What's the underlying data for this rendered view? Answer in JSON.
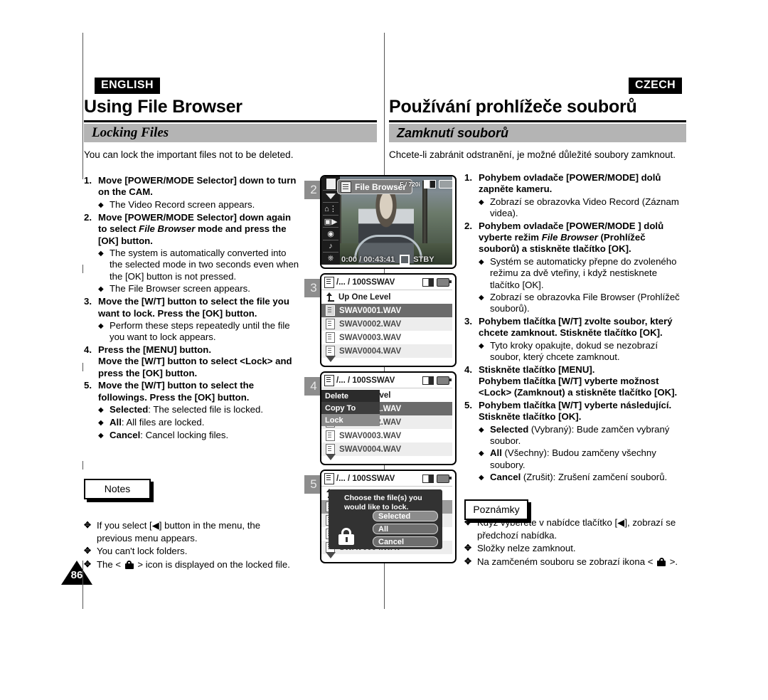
{
  "left": {
    "language_tag": "ENGLISH",
    "chapter_title": "Using File Browser",
    "section_title": "Locking Files",
    "intro": "You can lock the important files not to be deleted.",
    "steps": [
      {
        "num": "1.",
        "head_pre": "Move [POWER/MODE Selector] down to turn on the CAM.",
        "subs": [
          {
            "bold": "",
            "text": "The Video Record screen appears."
          }
        ]
      },
      {
        "num": "2.",
        "head_pre": "Move [POWER/MODE Selector] down again to select ",
        "head_ital": "File Browser",
        "head_post": " mode and press the [OK] button.",
        "subs": [
          {
            "bold": "",
            "text": "The system is automatically converted into the selected mode in two seconds even when the [OK] button is not pressed."
          },
          {
            "bold": "",
            "text": "The File Browser screen appears."
          }
        ]
      },
      {
        "num": "3.",
        "head_pre": "Move the [W/T] button to select the file you want to lock. Press the [OK] button.",
        "subs": [
          {
            "bold": "",
            "text": "Perform these steps repeatedly until the file you want to lock appears."
          }
        ]
      },
      {
        "num": "4.",
        "head_pre": "Press the [MENU] button.\nMove the [W/T] button to select <Lock> and press the [OK] button.",
        "subs": []
      },
      {
        "num": "5.",
        "head_pre": "Move the  [W/T] button to select the followings. Press the [OK] button.",
        "subs": [
          {
            "bold": "Selected",
            "text": ": The selected file is locked."
          },
          {
            "bold": "All",
            "text": ": All files are locked."
          },
          {
            "bold": "Cancel",
            "text": ": Cancel locking files."
          }
        ]
      }
    ],
    "notes_label": "Notes",
    "notes": [
      {
        "text": "If you select [◀] button in the menu, the previous menu appears.",
        "has_lock": false
      },
      {
        "text": "You can't lock folders.",
        "has_lock": false
      },
      {
        "pre": "The < ",
        "post": " > icon is displayed on the locked file.",
        "has_lock": true
      }
    ],
    "page_number": "86"
  },
  "right": {
    "language_tag": "CZECH",
    "chapter_title": "Používání prohlížeče souborů",
    "section_title": "Zamknutí souborů",
    "intro": "Chcete-li zabránit odstranění, je možné důležité soubory zamknout.",
    "steps": [
      {
        "num": "1.",
        "head_pre": "Pohybem ovladače [POWER/MODE] dolů zapněte kameru.",
        "subs": [
          {
            "bold": "",
            "text": "Zobrazí se obrazovka Video Record (Záznam videa)."
          }
        ]
      },
      {
        "num": "2.",
        "head_pre": "Pohybem ovladače [POWER/MODE ] dolů vyberte režim ",
        "head_ital": "File Browser",
        "head_post": " (Prohlížeč souborů) a stiskněte tlačítko [OK].",
        "subs": [
          {
            "bold": "",
            "text": "Systém se automaticky přepne do zvoleného režimu za dvě vteřiny, i když nestisknete tlačítko [OK]."
          },
          {
            "bold": "",
            "text": "Zobrazí se obrazovka File Browser (Prohlížeč souborů)."
          }
        ]
      },
      {
        "num": "3.",
        "head_pre": "Pohybem tlačítka [W/T] zvolte soubor, který chcete zamknout. Stiskněte tlačítko [OK].",
        "subs": [
          {
            "bold": "",
            "text": "Tyto kroky opakujte, dokud se nezobrazí soubor, který chcete zamknout."
          }
        ]
      },
      {
        "num": "4.",
        "head_pre": "Stiskněte tlačítko [MENU].\nPohybem tlačítka [W/T] vyberte možnost <Lock> (Zamknout) a stiskněte tlačítko [OK].",
        "subs": []
      },
      {
        "num": "5.",
        "head_pre": "Pohybem tlačítka [W/T] vyberte následující. Stiskněte tlačítko [OK].",
        "subs": [
          {
            "bold": "Selected",
            "text": " (Vybraný): Bude zamčen vybraný soubor."
          },
          {
            "bold": "All",
            "text": " (Všechny): Budou zamčeny všechny soubory."
          },
          {
            "bold": "Cancel",
            "text": " (Zrušit): Zrušení zamčení souborů."
          }
        ]
      }
    ],
    "notes_label": "Poznámky",
    "notes": [
      {
        "text": "Když vyberete v nabídce tlačítko [◀], zobrazí se předchozí nabídka.",
        "has_lock": false
      },
      {
        "text": "Složky nelze zamknout.",
        "has_lock": false
      },
      {
        "pre": "Na zamčeném souboru se zobrazí ikona < ",
        "post": " >.",
        "has_lock": true
      }
    ]
  },
  "figures": [
    {
      "badge": "2",
      "type": "video-preview",
      "mode_chip": "File Browser",
      "format": "F / 720i",
      "timecode": "0:00 / 00:43:41",
      "record_status": "STBY",
      "rail_icons": [
        "file-browser-icon",
        "chevron-down-icon",
        "settings-icon",
        "video-camera-icon",
        "photo-camera-icon",
        "music-note-icon",
        "microphone-icon"
      ]
    },
    {
      "badge": "3",
      "type": "file-list",
      "path": "/... / 100SSWAV",
      "up_label": "Up One Level",
      "files": [
        {
          "name": "SWAV0001.WAV",
          "selected": true
        },
        {
          "name": "SWAV0002.WAV",
          "selected": false
        },
        {
          "name": "SWAV0003.WAV",
          "selected": false
        },
        {
          "name": "SWAV0004.WAV",
          "selected": false
        }
      ]
    },
    {
      "badge": "4",
      "type": "file-list-menu",
      "path": "/... / 100SSWAV",
      "up_label": "Up One Level",
      "menu_items": [
        {
          "label": "Delete",
          "highlighted": false
        },
        {
          "label": "Copy To",
          "highlighted": false
        },
        {
          "label": "Lock",
          "highlighted": true
        }
      ],
      "files": [
        {
          "name": "SWAV0001.WAV",
          "selected": true
        },
        {
          "name": "SWAV0002.WAV",
          "selected": false
        },
        {
          "name": "SWAV0003.WAV",
          "selected": false
        },
        {
          "name": "SWAV0004.WAV",
          "selected": false
        }
      ]
    },
    {
      "badge": "5",
      "type": "lock-dialog",
      "path": "/... / 100SSWAV",
      "dialog_message": "Choose the file(s) you would like to lock.",
      "buttons": [
        {
          "label": "Selected",
          "highlighted": true
        },
        {
          "label": "All",
          "highlighted": false
        },
        {
          "label": "Cancel",
          "highlighted": false
        }
      ]
    }
  ]
}
